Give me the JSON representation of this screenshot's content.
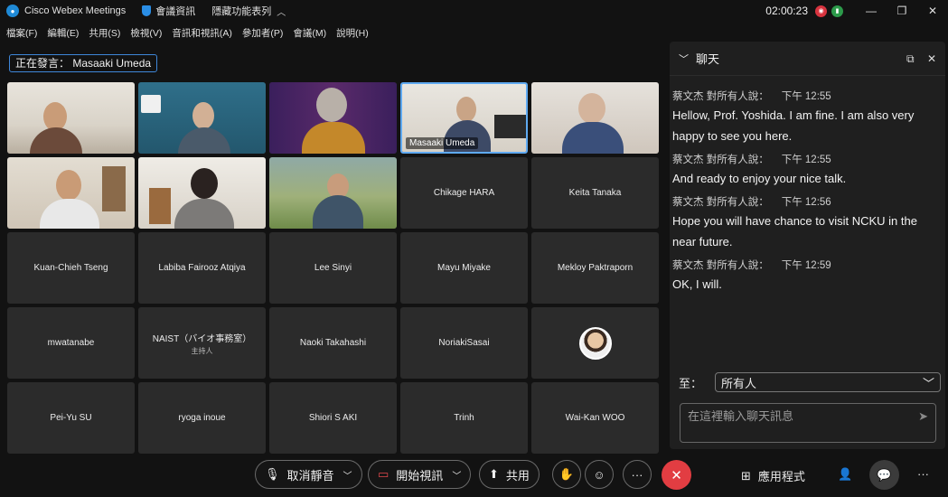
{
  "titlebar": {
    "app_name": "Cisco Webex Meetings",
    "meeting_info": "會議資訊",
    "hide_menu": "隱藏功能表列",
    "timer": "02:00:23"
  },
  "menu": [
    "檔案(F)",
    "編輯(E)",
    "共用(S)",
    "檢視(V)",
    "音訊和視訊(A)",
    "參加者(P)",
    "會議(M)",
    "說明(H)"
  ],
  "speaking": "正在發言： Masaaki Umeda",
  "participants": {
    "video_label": "Masaaki Umeda",
    "names": [
      "Chikage HARA",
      "Keita Tanaka",
      "Kuan-Chieh Tseng",
      "Labiba Fairooz Atqiya",
      "Lee Sinyi",
      "Mayu Miyake",
      "Mekloy Paktraporn",
      "mwatanabe",
      "NAIST（バイオ事務室）",
      "Naoki Takahashi",
      "NoriakiSasai",
      "Pei-Yu SU",
      "ryoga inoue",
      "Shiori S AKI",
      "Trinh",
      "Wai-Kan WOO"
    ],
    "host_tag": "主持人"
  },
  "chat": {
    "title": "聊天",
    "messages": [
      {
        "sender": "蔡文杰 對所有人說：",
        "time": "下午 12:55",
        "text": "Hellow, Prof. Yoshida. I am fine. I am also very happy to see you here."
      },
      {
        "sender": "蔡文杰 對所有人說：",
        "time": "下午 12:55",
        "text": "And ready to enjoy your nice talk."
      },
      {
        "sender": "蔡文杰 對所有人說：",
        "time": "下午 12:56",
        "text": "Hope you will have chance to visit NCKU in the near future."
      },
      {
        "sender": "蔡文杰 對所有人說：",
        "time": "下午 12:59",
        "text": "OK, I will."
      }
    ],
    "to_label": "至：",
    "to_value": "所有人",
    "input_placeholder": "在這裡輸入聊天訊息"
  },
  "toolbar": {
    "unmute": "取消靜音",
    "start_video": "開始視訊",
    "share": "共用",
    "apps": "應用程式"
  },
  "colors": {
    "end_button": "#e23d42",
    "active_border": "#5fa9f0",
    "speaking_border": "#3e86d8"
  }
}
